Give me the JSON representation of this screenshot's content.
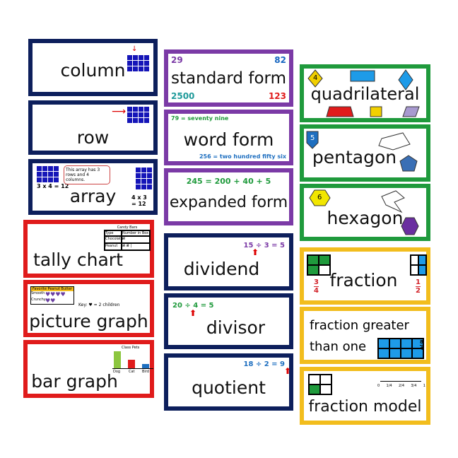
{
  "cards": {
    "column": {
      "word": "column"
    },
    "row": {
      "word": "row"
    },
    "array": {
      "word": "array",
      "left_eq": "3 x 4 = 12",
      "right_eq": "4 x 3 = 12",
      "bubble": "This array has 3 rows and 4 columns."
    },
    "tally": {
      "word": "tally chart",
      "table_title": "Candy Bars",
      "headers": [
        "Type",
        "Number in Box"
      ],
      "rows": [
        [
          "Chocolate",
          "𝍸"
        ],
        [
          "Peanut",
          "𝍸 𝍸 |"
        ]
      ]
    },
    "picture": {
      "word": "picture graph",
      "table_title": "Favorite Peanut Butter",
      "rows": [
        [
          "Smooth",
          "♥♥♥♥"
        ],
        [
          "Crunchy",
          "♥♥"
        ]
      ],
      "key": "Key: ♥ = 2 children"
    },
    "bar": {
      "word": "bar graph",
      "chart_title": "Class Pets",
      "categories": [
        "Dog",
        "Cat",
        "Bird"
      ]
    },
    "standard": {
      "word": "standard form",
      "tl": "29",
      "tr": "82",
      "bl": "2500",
      "br": "123"
    },
    "wordform": {
      "word": "word form",
      "top": "79 = seventy nine",
      "bottom": "256 = two hundred fifty six"
    },
    "expanded": {
      "word": "expanded form",
      "eq": "245 = 200 + 40 + 5"
    },
    "dividend": {
      "word": "dividend",
      "eq": "15 ÷ 3 = 5"
    },
    "divisor": {
      "word": "divisor",
      "eq": "20 ÷ 4 = 5"
    },
    "quotient": {
      "word": "quotient",
      "eq": "18 ÷ 2 = 9"
    },
    "quad": {
      "word": "quadrilateral",
      "num": "4"
    },
    "pentagon": {
      "word": "pentagon",
      "num": "5"
    },
    "hexagon": {
      "word": "hexagon",
      "num": "6"
    },
    "fraction": {
      "word": "fraction",
      "l_num": "3",
      "l_den": "4",
      "r_num": "1",
      "r_den": "2"
    },
    "greater": {
      "line1": "fraction greater",
      "line2": "than one",
      "num": "8",
      "den": "4"
    },
    "model": {
      "word": "fraction model",
      "ticks": [
        "0",
        "1/4",
        "2/4",
        "3/4",
        "1"
      ]
    }
  },
  "colors": {
    "navy": "#0d1f5c",
    "red": "#e01b1b",
    "purple": "#7b3aa6",
    "green": "#1f9a3c",
    "yellow": "#f2bd1d",
    "blue": "#1515b8",
    "sky": "#1e9be8"
  }
}
